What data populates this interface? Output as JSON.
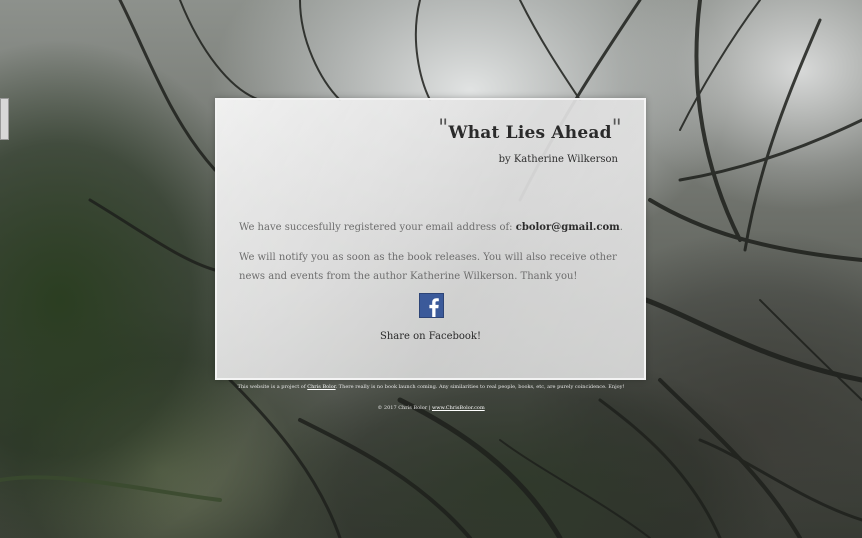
{
  "card": {
    "title": "What Lies Ahead",
    "quote_open": "\"",
    "quote_close": "\"",
    "byline": "by Katherine Wilkerson",
    "message1_before": "We have succesfully registered your email address of: ",
    "email": "cbolor@gmail.com",
    "message1_after": ".",
    "message2": "We will notify you as soon as the book releases. You will also receive other news and events from the author Katherine Wilkerson. Thank you!",
    "share_label": "Share on Facebook!",
    "facebook_icon": "facebook-icon",
    "facebook_color": "#3b5a9a"
  },
  "footer": {
    "line1_before": "This website is a project of ",
    "line1_link": "Chris Bolor",
    "line1_after": ". There really is no book launch coming. Any similarities to real people, books, etc, are purely coincidence. Enjoy!",
    "line2_before": "© 2017 Chris Bolor | ",
    "line2_link": "www.ChrisBolor.com"
  }
}
